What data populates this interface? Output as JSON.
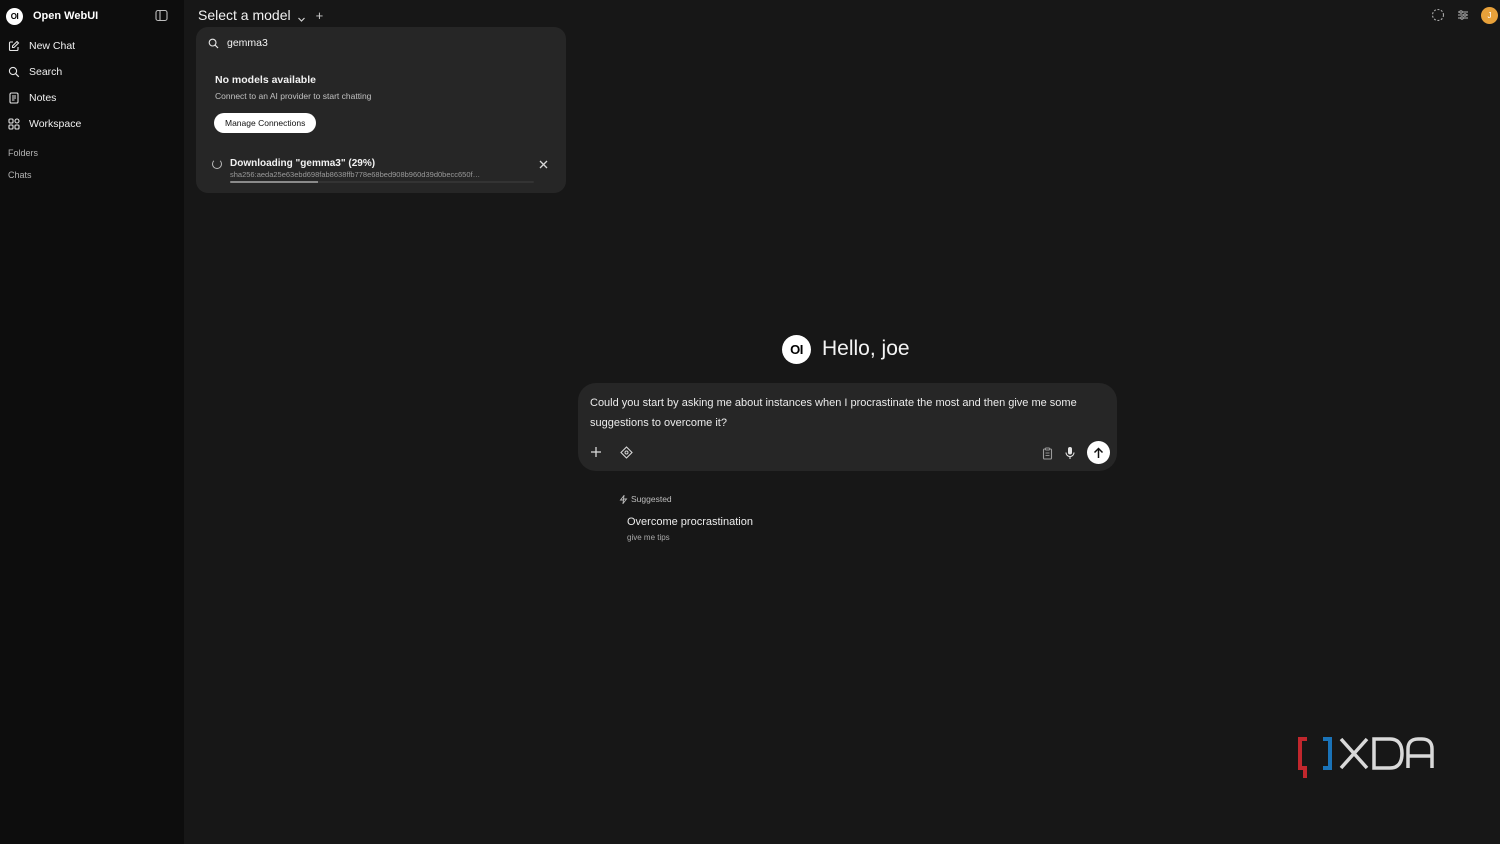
{
  "sidebar": {
    "brand": {
      "logo": "OI",
      "name": "Open WebUI"
    },
    "toggle_icon": "sidebar-toggle-icon",
    "items": [
      {
        "label": "New Chat",
        "icon": "edit-icon"
      },
      {
        "label": "Search",
        "icon": "search-icon"
      },
      {
        "label": "Notes",
        "icon": "notes-icon"
      },
      {
        "label": "Workspace",
        "icon": "grid-icon"
      }
    ],
    "sections": {
      "folders": "Folders",
      "chats": "Chats"
    }
  },
  "header": {
    "model_select_label": "Select a model",
    "user_initial": "J"
  },
  "model_dropdown": {
    "search_value": "gemma3",
    "empty_title": "No models available",
    "empty_subtitle": "Connect to an AI provider to start chatting",
    "manage_button": "Manage Connections",
    "download": {
      "title": "Downloading \"gemma3\" (29%)",
      "hash": "sha256:aeda25e63ebd698fab8638ffb778e68bed908b960d39d0becc650f…",
      "progress_fraction": 0.29
    }
  },
  "main": {
    "greeting_logo": "OI",
    "greeting": "Hello, joe",
    "composer_text": "Could you start by asking me about instances when I procrastinate the most and then give me some suggestions to overcome it?",
    "suggested": {
      "label": "Suggested",
      "title": "Overcome procrastination",
      "subtitle": "give me tips"
    }
  },
  "watermark": {
    "text": "XDA"
  },
  "colors": {
    "background": "#171717",
    "sidebar": "#0d0d0d",
    "panel": "#262626",
    "avatar": "#e8a13a",
    "xda_red": "#c1272d",
    "xda_blue": "#1a73b8"
  }
}
